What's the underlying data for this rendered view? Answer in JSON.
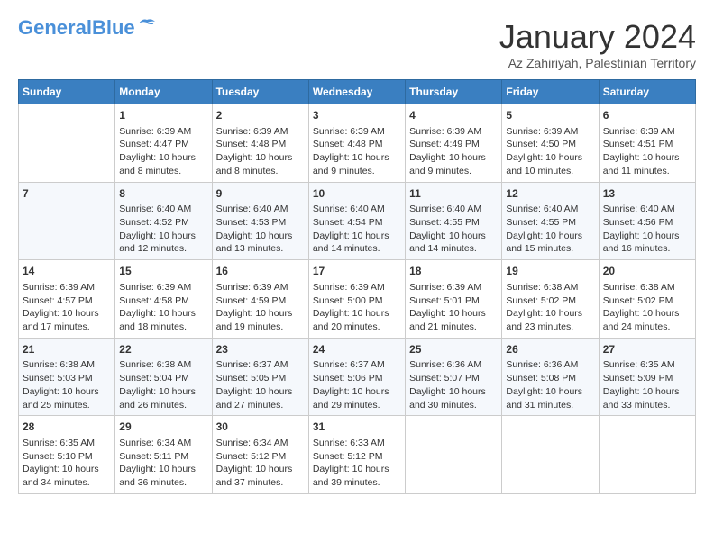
{
  "logo": {
    "general": "General",
    "blue": "Blue"
  },
  "header": {
    "title": "January 2024",
    "subtitle": "Az Zahiriyah, Palestinian Territory"
  },
  "weekdays": [
    "Sunday",
    "Monday",
    "Tuesday",
    "Wednesday",
    "Thursday",
    "Friday",
    "Saturday"
  ],
  "weeks": [
    [
      {
        "day": "",
        "content": ""
      },
      {
        "day": "1",
        "content": "Sunrise: 6:39 AM\nSunset: 4:47 PM\nDaylight: 10 hours\nand 8 minutes."
      },
      {
        "day": "2",
        "content": "Sunrise: 6:39 AM\nSunset: 4:48 PM\nDaylight: 10 hours\nand 8 minutes."
      },
      {
        "day": "3",
        "content": "Sunrise: 6:39 AM\nSunset: 4:48 PM\nDaylight: 10 hours\nand 9 minutes."
      },
      {
        "day": "4",
        "content": "Sunrise: 6:39 AM\nSunset: 4:49 PM\nDaylight: 10 hours\nand 9 minutes."
      },
      {
        "day": "5",
        "content": "Sunrise: 6:39 AM\nSunset: 4:50 PM\nDaylight: 10 hours\nand 10 minutes."
      },
      {
        "day": "6",
        "content": "Sunrise: 6:39 AM\nSunset: 4:51 PM\nDaylight: 10 hours\nand 11 minutes."
      }
    ],
    [
      {
        "day": "7",
        "content": ""
      },
      {
        "day": "8",
        "content": "Sunrise: 6:40 AM\nSunset: 4:52 PM\nDaylight: 10 hours\nand 12 minutes."
      },
      {
        "day": "9",
        "content": "Sunrise: 6:40 AM\nSunset: 4:53 PM\nDaylight: 10 hours\nand 13 minutes."
      },
      {
        "day": "10",
        "content": "Sunrise: 6:40 AM\nSunset: 4:54 PM\nDaylight: 10 hours\nand 14 minutes."
      },
      {
        "day": "11",
        "content": "Sunrise: 6:40 AM\nSunset: 4:55 PM\nDaylight: 10 hours\nand 14 minutes."
      },
      {
        "day": "12",
        "content": "Sunrise: 6:40 AM\nSunset: 4:55 PM\nDaylight: 10 hours\nand 15 minutes."
      },
      {
        "day": "13",
        "content": "Sunrise: 6:40 AM\nSunset: 4:56 PM\nDaylight: 10 hours\nand 16 minutes."
      }
    ],
    [
      {
        "day": "14",
        "content": "Sunrise: 6:39 AM\nSunset: 4:57 PM\nDaylight: 10 hours\nand 17 minutes."
      },
      {
        "day": "15",
        "content": "Sunrise: 6:39 AM\nSunset: 4:58 PM\nDaylight: 10 hours\nand 18 minutes."
      },
      {
        "day": "16",
        "content": "Sunrise: 6:39 AM\nSunset: 4:59 PM\nDaylight: 10 hours\nand 19 minutes."
      },
      {
        "day": "17",
        "content": "Sunrise: 6:39 AM\nSunset: 5:00 PM\nDaylight: 10 hours\nand 20 minutes."
      },
      {
        "day": "18",
        "content": "Sunrise: 6:39 AM\nSunset: 5:01 PM\nDaylight: 10 hours\nand 21 minutes."
      },
      {
        "day": "19",
        "content": "Sunrise: 6:38 AM\nSunset: 5:02 PM\nDaylight: 10 hours\nand 23 minutes."
      },
      {
        "day": "20",
        "content": "Sunrise: 6:38 AM\nSunset: 5:02 PM\nDaylight: 10 hours\nand 24 minutes."
      }
    ],
    [
      {
        "day": "21",
        "content": "Sunrise: 6:38 AM\nSunset: 5:03 PM\nDaylight: 10 hours\nand 25 minutes."
      },
      {
        "day": "22",
        "content": "Sunrise: 6:38 AM\nSunset: 5:04 PM\nDaylight: 10 hours\nand 26 minutes."
      },
      {
        "day": "23",
        "content": "Sunrise: 6:37 AM\nSunset: 5:05 PM\nDaylight: 10 hours\nand 27 minutes."
      },
      {
        "day": "24",
        "content": "Sunrise: 6:37 AM\nSunset: 5:06 PM\nDaylight: 10 hours\nand 29 minutes."
      },
      {
        "day": "25",
        "content": "Sunrise: 6:36 AM\nSunset: 5:07 PM\nDaylight: 10 hours\nand 30 minutes."
      },
      {
        "day": "26",
        "content": "Sunrise: 6:36 AM\nSunset: 5:08 PM\nDaylight: 10 hours\nand 31 minutes."
      },
      {
        "day": "27",
        "content": "Sunrise: 6:35 AM\nSunset: 5:09 PM\nDaylight: 10 hours\nand 33 minutes."
      }
    ],
    [
      {
        "day": "28",
        "content": "Sunrise: 6:35 AM\nSunset: 5:10 PM\nDaylight: 10 hours\nand 34 minutes."
      },
      {
        "day": "29",
        "content": "Sunrise: 6:34 AM\nSunset: 5:11 PM\nDaylight: 10 hours\nand 36 minutes."
      },
      {
        "day": "30",
        "content": "Sunrise: 6:34 AM\nSunset: 5:12 PM\nDaylight: 10 hours\nand 37 minutes."
      },
      {
        "day": "31",
        "content": "Sunrise: 6:33 AM\nSunset: 5:12 PM\nDaylight: 10 hours\nand 39 minutes."
      },
      {
        "day": "",
        "content": ""
      },
      {
        "day": "",
        "content": ""
      },
      {
        "day": "",
        "content": ""
      }
    ]
  ]
}
